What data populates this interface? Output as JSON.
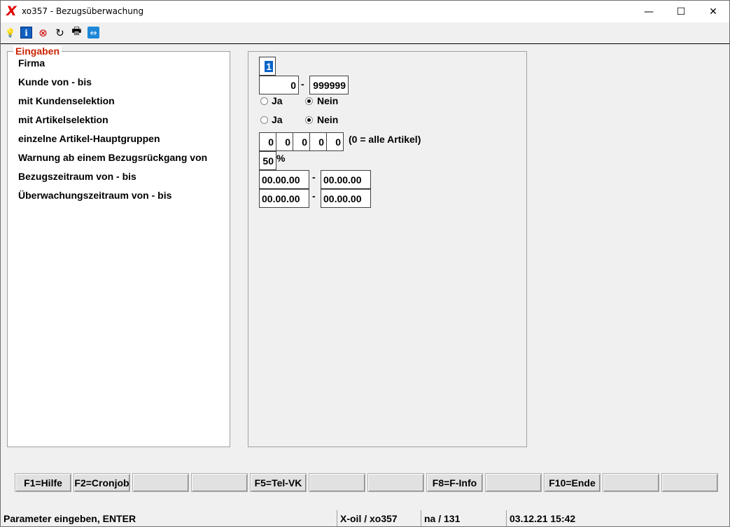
{
  "window": {
    "app_logo": "X",
    "title": "xo357 - Bezugsüberwachung",
    "min_glyph": "—",
    "max_glyph": "☐",
    "close_glyph": "✕"
  },
  "toolbar": {
    "icons": [
      {
        "name": "lightbulb-icon",
        "glyph": "💡"
      },
      {
        "name": "info-icon",
        "glyph": "ℹ"
      },
      {
        "name": "cancel-icon",
        "glyph": "⊗"
      },
      {
        "name": "refresh-icon",
        "glyph": "↻"
      },
      {
        "name": "print-icon",
        "glyph": "🖶"
      },
      {
        "name": "remote-icon",
        "glyph": "⇔"
      }
    ]
  },
  "form": {
    "legend": "Eingaben",
    "labels": {
      "firma": "Firma",
      "kunde": "Kunde von - bis",
      "kundenselektion": "mit Kundenselektion",
      "artikelselektion": "mit Artikelselektion",
      "hauptgruppen": "einzelne Artikel-Hauptgruppen",
      "warnung": "Warnung ab einem Bezugsrückgang von",
      "bezugszeitraum": "Bezugszeitraum von - bis",
      "ueberwachungszeitraum": "Überwachungszeitraum von - bis"
    },
    "firma_value": "1",
    "kunde_von": "0",
    "kunde_bis": "999999",
    "dash": "-",
    "radio_ja": "Ja",
    "radio_nein": "Nein",
    "kundenselektion_selected": "Nein",
    "artikelselektion_selected": "Nein",
    "hauptgruppen": [
      "0",
      "0",
      "0",
      "0",
      "0"
    ],
    "hauptgruppen_hint": "(0 = alle Artikel)",
    "warnung_value": "50",
    "percent": "%",
    "bezug_von": "00.00.00",
    "bezug_bis": "00.00.00",
    "ueberwachung_von": "00.00.00",
    "ueberwachung_bis": "00.00.00"
  },
  "fkeys": [
    "F1=Hilfe",
    "F2=Cronjob",
    "",
    "",
    "F5=Tel-VK",
    "",
    "",
    "F8=F-Info",
    "",
    "F10=Ende",
    "",
    ""
  ],
  "status": {
    "message": "Parameter eingeben, ENTER",
    "program": "X-oil / xo357",
    "user": "na / 131",
    "datetime": "03.12.21 15:42"
  }
}
